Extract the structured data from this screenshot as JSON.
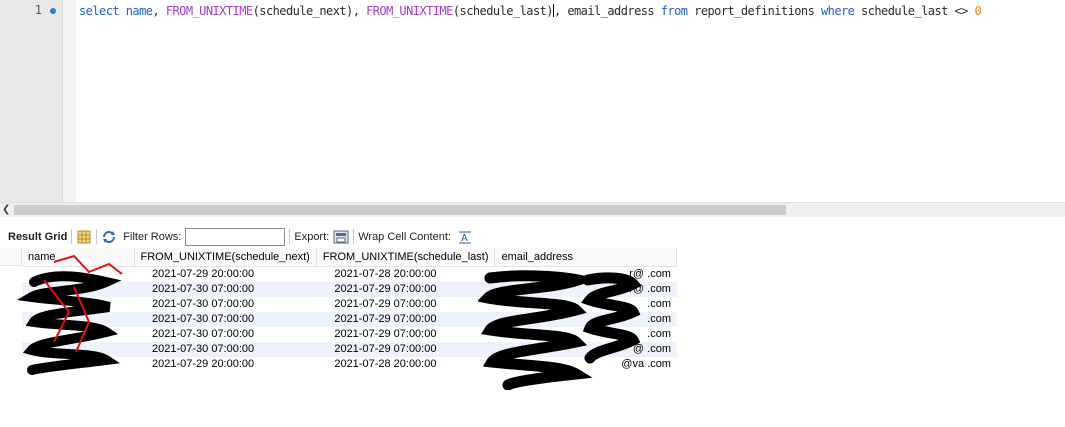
{
  "editor": {
    "line_number": "1",
    "query_tokens": [
      {
        "t": "select",
        "c": "kw"
      },
      {
        "t": " ",
        "c": "id"
      },
      {
        "t": "name",
        "c": "kw"
      },
      {
        "t": ", ",
        "c": "id"
      },
      {
        "t": "FROM_UNIXTIME",
        "c": "fn"
      },
      {
        "t": "(schedule_next), ",
        "c": "id"
      },
      {
        "t": "FROM_UNIXTIME",
        "c": "fn"
      },
      {
        "t": "(schedule_last)",
        "c": "id"
      },
      {
        "t": ", email_address ",
        "c": "id"
      },
      {
        "t": "from",
        "c": "kw"
      },
      {
        "t": " report_definitions ",
        "c": "id"
      },
      {
        "t": "where",
        "c": "kw"
      },
      {
        "t": " schedule_last <> ",
        "c": "id"
      },
      {
        "t": "0",
        "c": "num"
      }
    ]
  },
  "toolbar": {
    "result_grid_label": "Result Grid",
    "filter_rows_label": "Filter Rows:",
    "filter_value": "",
    "export_label": "Export:",
    "wrap_label": "Wrap Cell Content:"
  },
  "grid": {
    "columns": [
      "name",
      "FROM_UNIXTIME(schedule_next)",
      "FROM_UNIXTIME(schedule_last)",
      "email_address"
    ],
    "rows": [
      {
        "name": "",
        "next": "2021-07-29 20:00:00",
        "last": "2021-07-28 20:00:00",
        "email": "r@ .com"
      },
      {
        "name": "",
        "next": "2021-07-30 07:00:00",
        "last": "2021-07-29 07:00:00",
        "email": "r@ .com"
      },
      {
        "name": "",
        "next": "2021-07-30 07:00:00",
        "last": "2021-07-29 07:00:00",
        "email": ".com"
      },
      {
        "name": "",
        "next": "2021-07-30 07:00:00",
        "last": "2021-07-29 07:00:00",
        "email": ".com"
      },
      {
        "name": "",
        "next": "2021-07-30 07:00:00",
        "last": "2021-07-29 07:00:00",
        "email": ".com"
      },
      {
        "name": "",
        "next": "2021-07-30 07:00:00",
        "last": "2021-07-29 07:00:00",
        "email": "@ .com"
      },
      {
        "name": "",
        "next": "2021-07-29 20:00:00",
        "last": "2021-07-28 20:00:00",
        "email": "@va .com"
      }
    ]
  },
  "colors": {
    "keyword": "#1f5fc8",
    "function": "#a23ec9",
    "number": "#e08a1e",
    "alt_row": "#eef3fb"
  }
}
